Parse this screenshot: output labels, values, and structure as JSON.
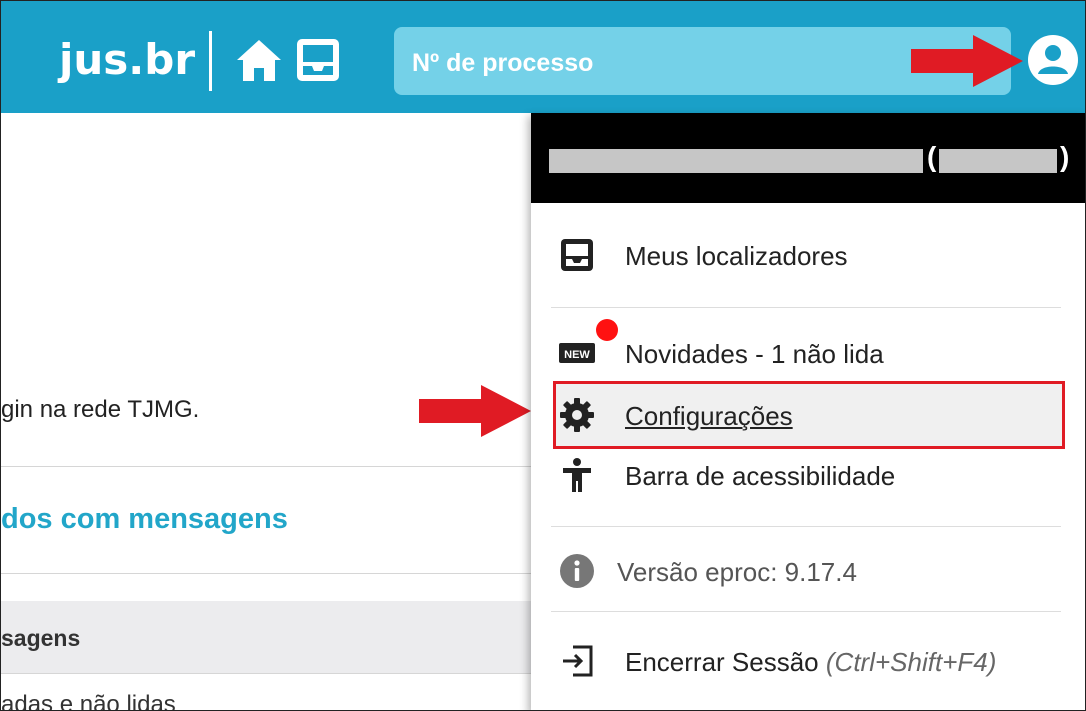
{
  "header": {
    "logo": "jus.br",
    "search": {
      "placeholder": "Nº de processo"
    },
    "icons": [
      "home-icon",
      "inbox-icon",
      "user-circle-icon"
    ],
    "bar_color": "#1aa0c8"
  },
  "background_page": {
    "message": "gin na rede TJMG.",
    "heading": "dos com mensagens",
    "band_text": "sagens",
    "bottom_text": "adas e não lidas"
  },
  "user_menu": {
    "user_id_open": "(",
    "user_id_close": ")",
    "items": [
      {
        "label": "Meus localizadores",
        "icon": "inbox-icon"
      },
      {
        "label": "Novidades - 1 não lida",
        "icon": "new-badge-icon",
        "unread_indicator": true
      },
      {
        "label": "Configurações",
        "icon": "gear-icon",
        "highlighted": true
      },
      {
        "label": "Barra de acessibilidade",
        "icon": "accessibility-icon"
      },
      {
        "label": "Versão eproc: 9.17.4",
        "icon": "info-icon"
      },
      {
        "label": "Encerrar Sessão",
        "shortcut": "(Ctrl+Shift+F4)",
        "icon": "logout-icon"
      }
    ]
  },
  "annotations": {
    "arrow_color": "#e01b24",
    "highlight_color": "#e01b24"
  }
}
